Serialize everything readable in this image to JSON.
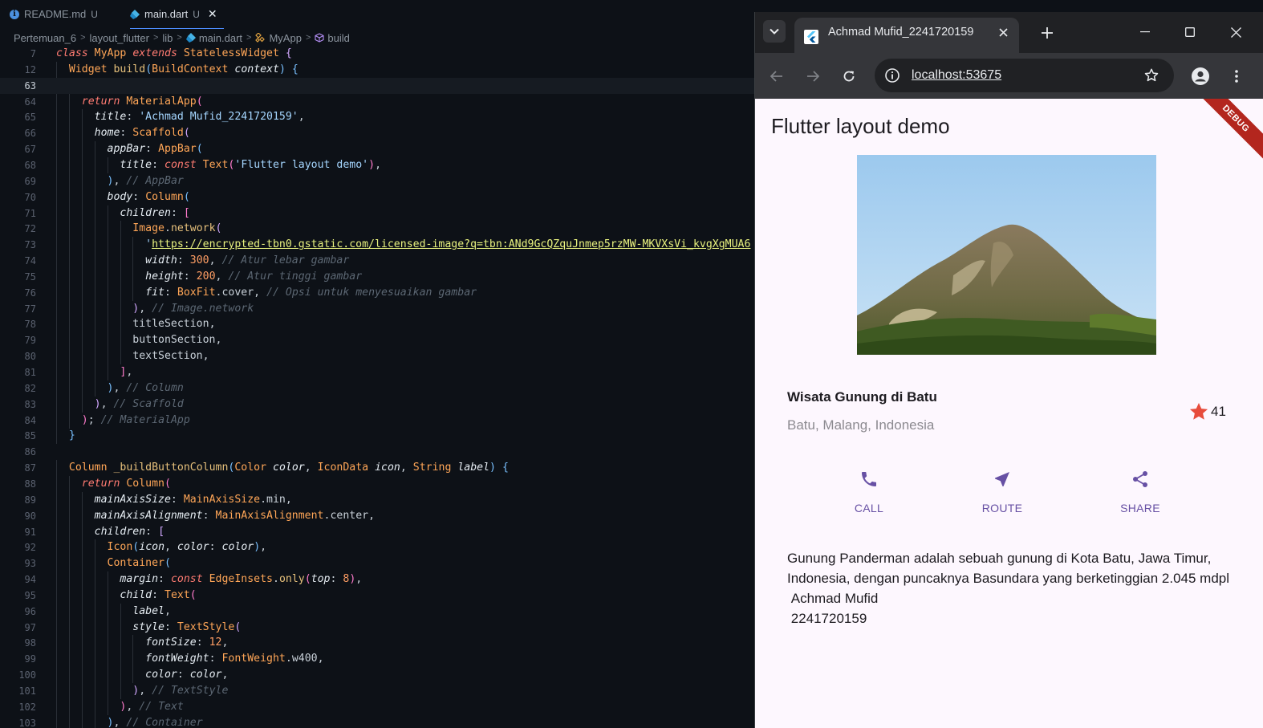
{
  "editor": {
    "tabs": [
      {
        "label": "README.md",
        "status": "U"
      },
      {
        "label": "main.dart",
        "status": "U"
      }
    ],
    "breadcrumb": [
      "Pertemuan_6",
      "layout_flutter",
      "lib",
      "main.dart",
      "MyApp",
      "build"
    ],
    "code_lines": [
      {
        "n": "7",
        "html": "<span class=\"kw\">class</span> <span class=\"ty\">MyApp</span> <span class=\"kw\">extends</span> <span class=\"ty\">StatelessWidget</span> <span class=\"pp\">{</span>"
      },
      {
        "n": "12",
        "html": "  <span class=\"ty\">Widget</span> <span class=\"fn\">build</span><span class=\"pb\">(</span><span class=\"ty\">BuildContext</span> <span class=\"pr\">context</span><span class=\"pb\">)</span> <span class=\"pb\">{</span>"
      },
      {
        "n": "63",
        "html": "",
        "current": true
      },
      {
        "n": "64",
        "html": "    <span class=\"kw\">return</span> <span class=\"ty\">MaterialApp</span><span class=\"pk\">(</span>"
      },
      {
        "n": "65",
        "html": "      <span class=\"pr\">title</span>: <span class=\"st\">'Achmad Mufid_2241720159'</span>,"
      },
      {
        "n": "66",
        "html": "      <span class=\"pr\">home</span>: <span class=\"ty\">Scaffold</span><span class=\"pp\">(</span>"
      },
      {
        "n": "67",
        "html": "        <span class=\"pr\">appBar</span>: <span class=\"ty\">AppBar</span><span class=\"pb\">(</span>"
      },
      {
        "n": "68",
        "html": "          <span class=\"pr\">title</span>: <span class=\"kw\">const</span> <span class=\"ty\">Text</span><span class=\"pk\">(</span><span class=\"st\">'Flutter layout demo'</span><span class=\"pk\">)</span>,"
      },
      {
        "n": "69",
        "html": "        <span class=\"pb\">)</span>, <span class=\"cm\">// AppBar</span>"
      },
      {
        "n": "70",
        "html": "        <span class=\"pr\">body</span>: <span class=\"ty\">Column</span><span class=\"pb\">(</span>"
      },
      {
        "n": "71",
        "html": "          <span class=\"pr\">children</span>: <span class=\"pk\">[</span>"
      },
      {
        "n": "72",
        "html": "            <span class=\"ty\">Image</span>.<span class=\"fn\">network</span><span class=\"pp\">(</span>"
      },
      {
        "n": "73",
        "html": "              <span class=\"st\">'</span><span class=\"url\">https://encrypted-tbn0.gstatic.com/licensed-image?q=tbn:ANd9GcQZquJnmep5rzMW-MKVXsVi_kvgXgMUA6</span>"
      },
      {
        "n": "74",
        "html": "              <span class=\"pr\">width</span>: <span class=\"nm\">300</span>, <span class=\"cm\">// Atur lebar gambar</span>"
      },
      {
        "n": "75",
        "html": "              <span class=\"pr\">height</span>: <span class=\"nm\">200</span>, <span class=\"cm\">// Atur tinggi gambar</span>"
      },
      {
        "n": "76",
        "html": "              <span class=\"pr\">fit</span>: <span class=\"ty\">BoxFit</span>.<span class=\"id\">cover</span>, <span class=\"cm\">// Opsi untuk menyesuaikan gambar</span>"
      },
      {
        "n": "77",
        "html": "            <span class=\"pp\">)</span>, <span class=\"cm\">// Image.network</span>"
      },
      {
        "n": "78",
        "html": "            <span class=\"id\">titleSection</span>,"
      },
      {
        "n": "79",
        "html": "            <span class=\"id\">buttonSection</span>,"
      },
      {
        "n": "80",
        "html": "            <span class=\"id\">textSection</span>,"
      },
      {
        "n": "81",
        "html": "          <span class=\"pk\">]</span>,"
      },
      {
        "n": "82",
        "html": "        <span class=\"pb\">)</span>, <span class=\"cm\">// Column</span>"
      },
      {
        "n": "83",
        "html": "      <span class=\"pp\">)</span>, <span class=\"cm\">// Scaffold</span>"
      },
      {
        "n": "84",
        "html": "    <span class=\"pk\">)</span>; <span class=\"cm\">// MaterialApp</span>"
      },
      {
        "n": "85",
        "html": "  <span class=\"pb\">}</span>"
      },
      {
        "n": "86",
        "html": ""
      },
      {
        "n": "87",
        "html": "  <span class=\"ty\">Column</span> <span class=\"fn\">_buildButtonColumn</span><span class=\"pb\">(</span><span class=\"ty\">Color</span> <span class=\"pr\">color</span>, <span class=\"ty\">IconData</span> <span class=\"pr\">icon</span>, <span class=\"ty\">String</span> <span class=\"pr\">label</span><span class=\"pb\">)</span> <span class=\"pb\">{</span>"
      },
      {
        "n": "88",
        "html": "    <span class=\"kw\">return</span> <span class=\"ty\">Column</span><span class=\"pk\">(</span>"
      },
      {
        "n": "89",
        "html": "      <span class=\"pr\">mainAxisSize</span>: <span class=\"ty\">MainAxisSize</span>.<span class=\"id\">min</span>,"
      },
      {
        "n": "90",
        "html": "      <span class=\"pr\">mainAxisAlignment</span>: <span class=\"ty\">MainAxisAlignment</span>.<span class=\"id\">center</span>,"
      },
      {
        "n": "91",
        "html": "      <span class=\"pr\">children</span>: <span class=\"pp\">[</span>"
      },
      {
        "n": "92",
        "html": "        <span class=\"ty\">Icon</span><span class=\"pb\">(</span><span class=\"pr\">icon</span>, <span class=\"pr\">color</span>: <span class=\"pr\">color</span><span class=\"pb\">)</span>,"
      },
      {
        "n": "93",
        "html": "        <span class=\"ty\">Container</span><span class=\"pb\">(</span>"
      },
      {
        "n": "94",
        "html": "          <span class=\"pr\">margin</span>: <span class=\"kw\">const</span> <span class=\"ty\">EdgeInsets</span>.<span class=\"fn\">only</span><span class=\"pk\">(</span><span class=\"pr\">top</span>: <span class=\"nm\">8</span><span class=\"pk\">)</span>,"
      },
      {
        "n": "95",
        "html": "          <span class=\"pr\">child</span>: <span class=\"ty\">Text</span><span class=\"pk\">(</span>"
      },
      {
        "n": "96",
        "html": "            <span class=\"pr\">label</span>,"
      },
      {
        "n": "97",
        "html": "            <span class=\"pr\">style</span>: <span class=\"ty\">TextStyle</span><span class=\"pp\">(</span>"
      },
      {
        "n": "98",
        "html": "              <span class=\"pr\">fontSize</span>: <span class=\"nm\">12</span>,"
      },
      {
        "n": "99",
        "html": "              <span class=\"pr\">fontWeight</span>: <span class=\"ty\">FontWeight</span>.<span class=\"id\">w400</span>,"
      },
      {
        "n": "100",
        "html": "              <span class=\"pr\">color</span>: <span class=\"pr\">color</span>,"
      },
      {
        "n": "101",
        "html": "            <span class=\"pp\">)</span>, <span class=\"cm\">// TextStyle</span>"
      },
      {
        "n": "102",
        "html": "          <span class=\"pk\">)</span>, <span class=\"cm\">// Text</span>"
      },
      {
        "n": "103",
        "html": "        <span class=\"pb\">)</span>, <span class=\"cm\">// Container</span>"
      }
    ]
  },
  "browser": {
    "tab_title": "Achmad Mufid_2241720159",
    "url": "localhost:53675",
    "app": {
      "appbar_title": "Flutter layout demo",
      "debug_banner": "DEBUG",
      "place_name": "Wisata Gunung di Batu",
      "place_location": "Batu, Malang, Indonesia",
      "star_count": "41",
      "buttons": [
        {
          "label": "CALL",
          "icon": "phone-icon"
        },
        {
          "label": "ROUTE",
          "icon": "near-me-icon"
        },
        {
          "label": "SHARE",
          "icon": "share-icon"
        }
      ],
      "description": "Gunung Panderman adalah sebuah gunung di Kota Batu, Jawa Timur, Indonesia, dengan puncaknya Basundara yang berketinggian 2.045 mdpl\n Achmad Mufid\n 2241720159",
      "colors": {
        "primary": "#6750a4",
        "star": "#e74c3c",
        "surface": "#fdf7fe",
        "debug": "#b3261e"
      }
    }
  }
}
